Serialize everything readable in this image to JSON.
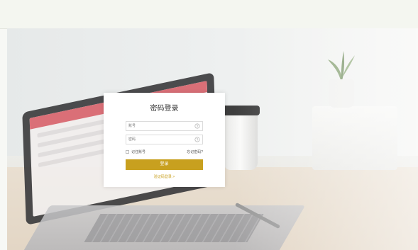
{
  "header": {
    "links": []
  },
  "login": {
    "title": "密码登录",
    "account_placeholder": "账号",
    "password_placeholder": "密码",
    "remember_label": "记住账号",
    "forgot_label": "忘记密码?",
    "submit_label": "登录",
    "alt_login_label": "验证码登录 >"
  },
  "colors": {
    "accent": "#c8a01f",
    "header_bg": "#f4f6f0"
  },
  "icons": {
    "account": "help-circle-icon",
    "password": "help-circle-icon"
  }
}
